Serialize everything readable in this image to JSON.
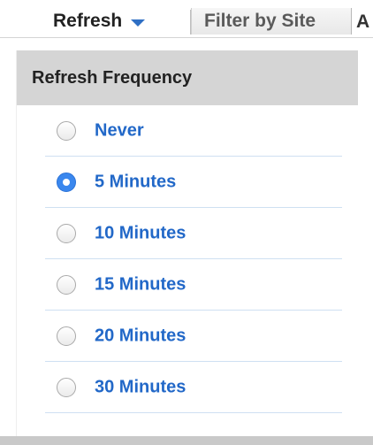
{
  "toolbar": {
    "refresh_label": "Refresh",
    "filter_label": "Filter by Site",
    "next_tab_partial": "A"
  },
  "panel": {
    "title": "Refresh Frequency",
    "selected": "5 Minutes",
    "options": [
      {
        "label": "Never",
        "checked": false
      },
      {
        "label": "5 Minutes",
        "checked": true
      },
      {
        "label": "10 Minutes",
        "checked": false
      },
      {
        "label": "15 Minutes",
        "checked": false
      },
      {
        "label": "20 Minutes",
        "checked": false
      },
      {
        "label": "30 Minutes",
        "checked": false
      }
    ]
  },
  "colors": {
    "accent": "#2268c8",
    "radio_checked": "#3a87ee",
    "header_bg": "#d5d5d5",
    "divider": "#cfe0f2"
  },
  "icons": {
    "dropdown": "caret-down-icon",
    "radio_on": "radio-checked-icon",
    "radio_off": "radio-unchecked-icon"
  }
}
